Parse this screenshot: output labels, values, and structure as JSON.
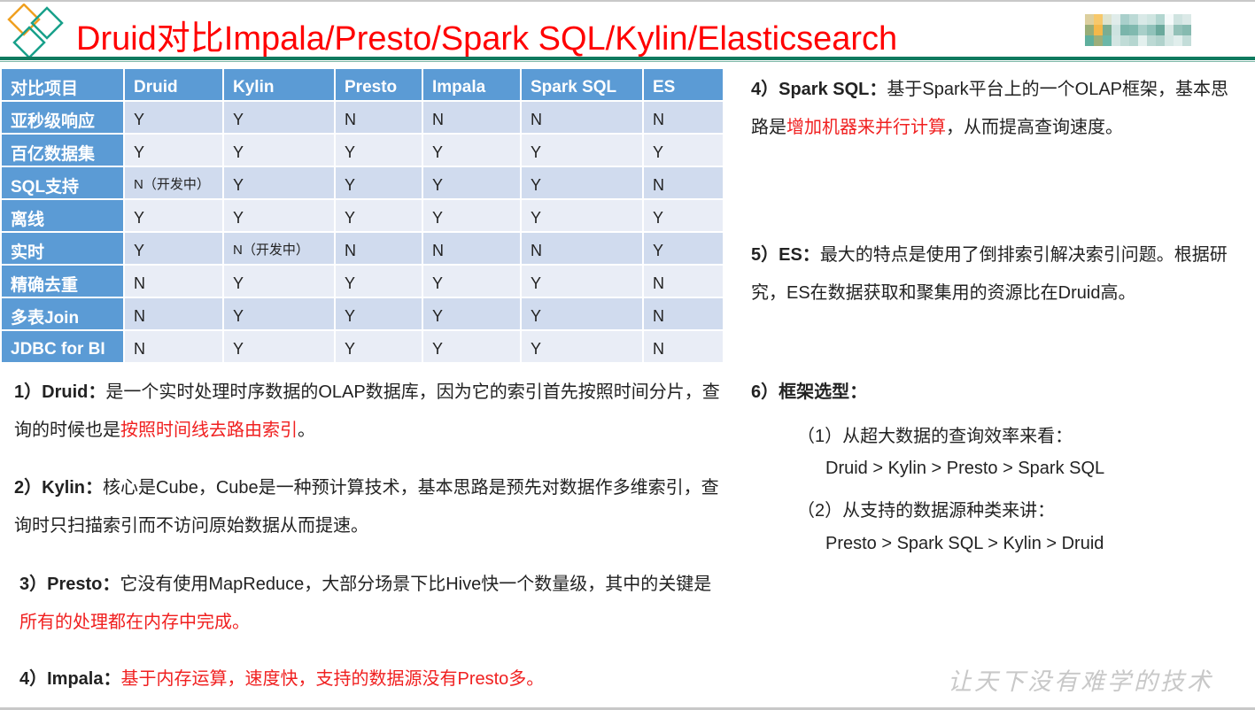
{
  "title": "Druid对比Impala/Presto/Spark SQL/Kylin/Elasticsearch",
  "table": {
    "headers": [
      "对比项目",
      "Druid",
      "Kylin",
      "Presto",
      "Impala",
      "Spark SQL",
      "ES"
    ],
    "rows": [
      [
        "亚秒级响应",
        "Y",
        "Y",
        "N",
        "N",
        "N",
        "N"
      ],
      [
        "百亿数据集",
        "Y",
        "Y",
        "Y",
        "Y",
        "Y",
        "Y"
      ],
      [
        "SQL支持",
        "N（开发中）",
        "Y",
        "Y",
        "Y",
        "Y",
        "N"
      ],
      [
        "离线",
        "Y",
        "Y",
        "Y",
        "Y",
        "Y",
        "Y"
      ],
      [
        "实时",
        "Y",
        "N（开发中）",
        "N",
        "N",
        "N",
        "Y"
      ],
      [
        "精确去重",
        "N",
        "Y",
        "Y",
        "Y",
        "Y",
        "N"
      ],
      [
        "多表Join",
        "N",
        "Y",
        "Y",
        "Y",
        "Y",
        "N"
      ],
      [
        "JDBC for BI",
        "N",
        "Y",
        "Y",
        "Y",
        "Y",
        "N"
      ]
    ]
  },
  "left": {
    "druid": {
      "label": "1）Druid：",
      "text": "是一个实时处理时序数据的OLAP数据库，因为它的索引首先按照时间分片，查询的时候也是",
      "red": "按照时间线去路由索引",
      "end": "。"
    },
    "kylin": {
      "label": "2）Kylin：",
      "text": "核心是Cube，Cube是一种预计算技术，基本思路是预先对数据作多维索引，查询时只扫描索引而不访问原始数据从而提速。"
    },
    "presto": {
      "label": "3）Presto：",
      "text": "它没有使用MapReduce，大部分场景下比Hive快一个数量级，其中的关键是",
      "red": "所有的处理都在内存中完成。"
    },
    "impala": {
      "label": "4）Impala：",
      "red": "基于内存运算，速度快，支持的数据源没有Presto多。"
    }
  },
  "right": {
    "spark": {
      "label": "4）Spark SQL：",
      "text": "基于Spark平台上的一个OLAP框架，基本思路是",
      "red": "增加机器来并行计算",
      "end": "，从而提高查询速度。"
    },
    "es": {
      "label": "5）ES：",
      "text": "最大的特点是使用了倒排索引解决索引问题。根据研究，ES在数据获取和聚集用的资源比在Druid高。"
    },
    "select": {
      "label": "6）框架选型：",
      "item1": "（1）从超大数据的查询效率来看：",
      "rank1": "Druid > Kylin > Presto > Spark SQL",
      "item2": "（2）从支持的数据源种类来讲：",
      "rank2": "Presto > Spark SQL > Kylin > Druid"
    }
  },
  "footer": "让天下没有难学的技术",
  "colors": {
    "accent": "#ff0000",
    "table_header": "#5b9bd5",
    "rule": "#0f7a5e"
  }
}
